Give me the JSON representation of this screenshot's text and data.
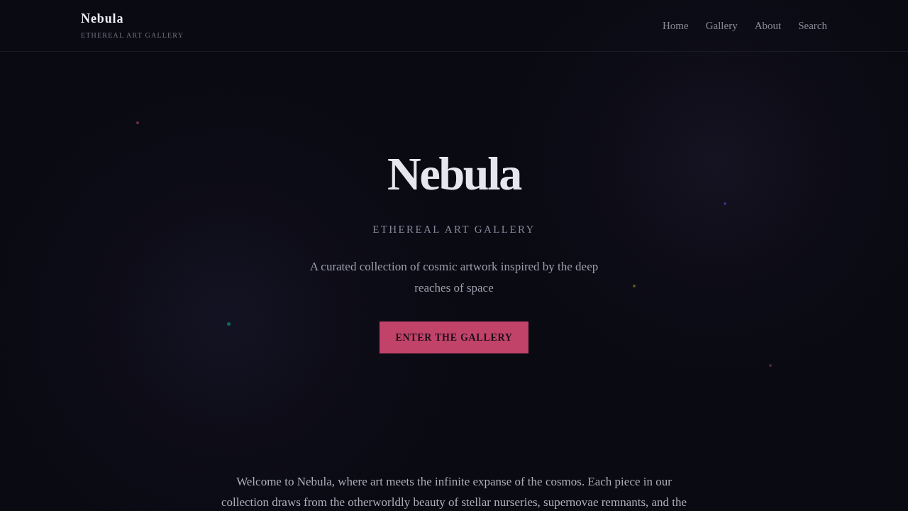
{
  "header": {
    "logo": "Nebula",
    "tagline": "ETHEREAL ART GALLERY",
    "nav": [
      "Home",
      "Gallery",
      "About",
      "Search"
    ]
  },
  "particles": [
    {
      "color": "#7a2a48"
    },
    {
      "color": "#0e6a5a"
    },
    {
      "color": "#3a2d8c"
    },
    {
      "color": "#6a5520"
    },
    {
      "color": "#5c2040"
    }
  ],
  "hero": {
    "title": "Nebula",
    "subtitle": "ETHEREAL ART GALLERY",
    "description": "A curated collection of cosmic artwork inspired by the deep reaches of space",
    "button": "ENTER THE GALLERY"
  },
  "intro": "Welcome to Nebula, where art meets the infinite expanse of the cosmos. Each piece in our collection draws from the otherworldly beauty of stellar nurseries, supernovae remnants, and the"
}
